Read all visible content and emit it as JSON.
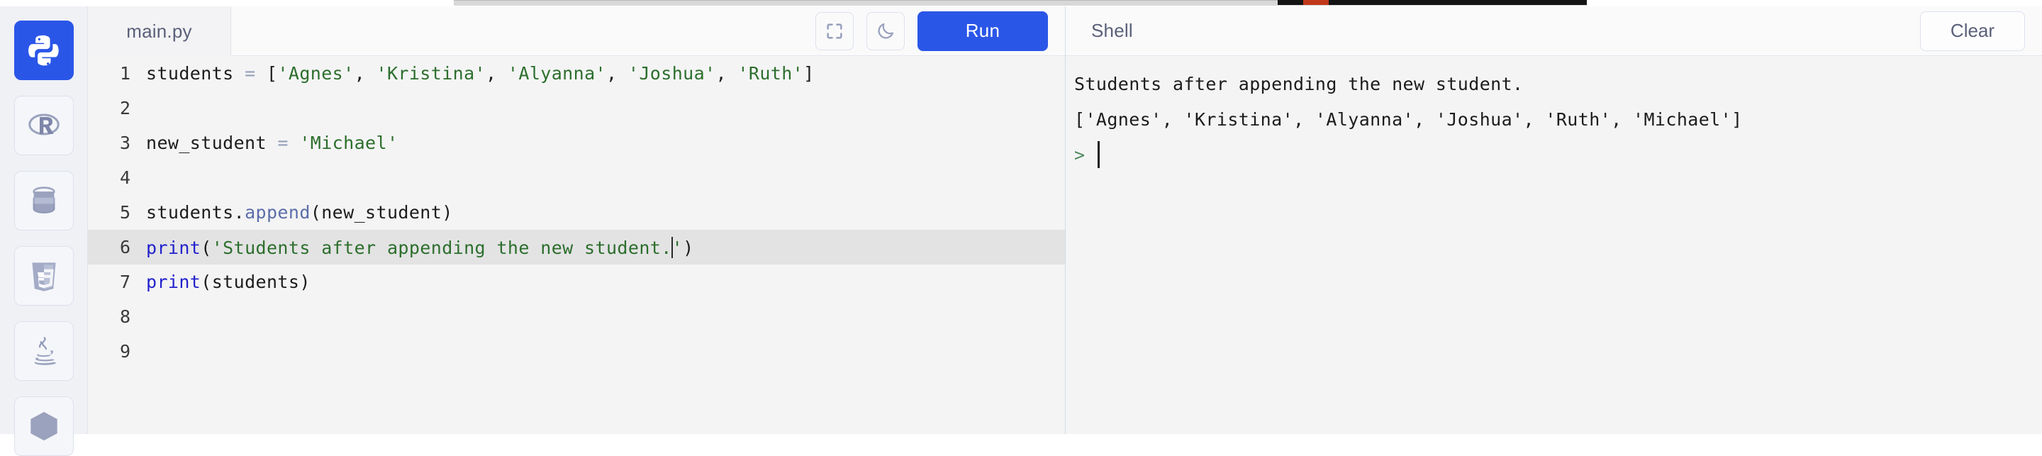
{
  "colors": {
    "accent": "#2a56e8",
    "editor_bg": "#f4f4f5",
    "sidebar_bg": "#eff1f5",
    "string_green": "#2c6e2c",
    "builtin_blue": "#2222cc",
    "prompt_green": "#4e8a5c",
    "highlight_line": "#e3e3e4"
  },
  "sidebar": {
    "items": [
      {
        "name": "python-icon",
        "label": "Python",
        "active": true
      },
      {
        "name": "r-icon",
        "label": "R",
        "active": false
      },
      {
        "name": "database-icon",
        "label": "Database",
        "active": false
      },
      {
        "name": "html5-icon",
        "label": "HTML5",
        "active": false
      },
      {
        "name": "java-icon",
        "label": "Java",
        "active": false
      },
      {
        "name": "nodejs-icon",
        "label": "Node.js",
        "active": false
      }
    ]
  },
  "editor": {
    "tab_label": "main.py",
    "fullscreen_icon": "fullscreen-icon",
    "theme_icon": "moon-icon",
    "run_label": "Run",
    "highlighted_line": 6,
    "cursor_line": 6,
    "lines": [
      {
        "num": "1",
        "tokens": [
          {
            "t": "students ",
            "c": "plain"
          },
          {
            "t": "=",
            "c": "op"
          },
          {
            "t": " [",
            "c": "plain"
          },
          {
            "t": "'Agnes'",
            "c": "str"
          },
          {
            "t": ", ",
            "c": "plain"
          },
          {
            "t": "'Kristina'",
            "c": "str"
          },
          {
            "t": ", ",
            "c": "plain"
          },
          {
            "t": "'Alyanna'",
            "c": "str"
          },
          {
            "t": ", ",
            "c": "plain"
          },
          {
            "t": "'Joshua'",
            "c": "str"
          },
          {
            "t": ", ",
            "c": "plain"
          },
          {
            "t": "'Ruth'",
            "c": "str"
          },
          {
            "t": "]",
            "c": "plain"
          }
        ]
      },
      {
        "num": "2",
        "tokens": []
      },
      {
        "num": "3",
        "tokens": [
          {
            "t": "new_student ",
            "c": "plain"
          },
          {
            "t": "=",
            "c": "op"
          },
          {
            "t": " ",
            "c": "plain"
          },
          {
            "t": "'Michael'",
            "c": "str"
          }
        ]
      },
      {
        "num": "4",
        "tokens": []
      },
      {
        "num": "5",
        "tokens": [
          {
            "t": "students.",
            "c": "plain"
          },
          {
            "t": "append",
            "c": "method"
          },
          {
            "t": "(new_student)",
            "c": "plain"
          }
        ]
      },
      {
        "num": "6",
        "tokens": [
          {
            "t": "print",
            "c": "fn"
          },
          {
            "t": "(",
            "c": "plain"
          },
          {
            "t": "'Students after appending the new student.",
            "c": "str"
          },
          {
            "t": "",
            "c": "caret"
          },
          {
            "t": "'",
            "c": "str"
          },
          {
            "t": ")",
            "c": "plain"
          }
        ]
      },
      {
        "num": "7",
        "tokens": [
          {
            "t": "print",
            "c": "fn"
          },
          {
            "t": "(students)",
            "c": "plain"
          }
        ]
      },
      {
        "num": "8",
        "tokens": []
      },
      {
        "num": "9",
        "tokens": []
      }
    ]
  },
  "shell": {
    "title": "Shell",
    "clear_label": "Clear",
    "prompt_symbol": ">",
    "output_lines": [
      "Students after appending the new student.",
      "['Agnes', 'Kristina', 'Alyanna', 'Joshua', 'Ruth', 'Michael']"
    ],
    "input_value": ""
  }
}
